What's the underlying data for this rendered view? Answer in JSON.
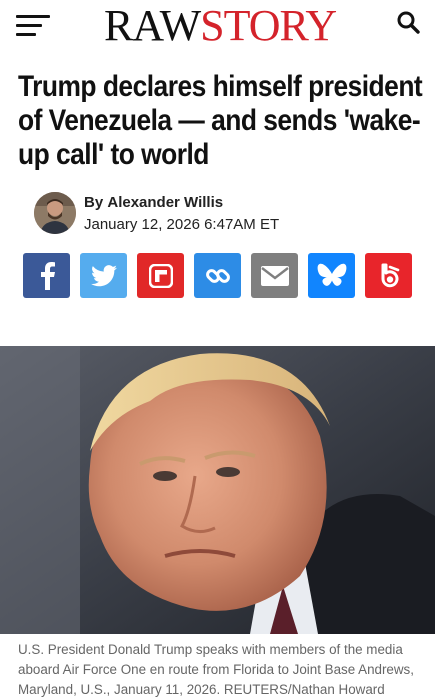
{
  "header": {
    "logo_part1": "RAW",
    "logo_part2": "STORY",
    "icons": {
      "menu": "hamburger-menu-icon",
      "search": "search-icon"
    }
  },
  "article": {
    "title": "Trump declares himself president of Venezuela — and sends 'wake-up call' to world",
    "byline_prefix": "By",
    "author": "Alexander Willis",
    "date": "January 12, 2026 6:47AM ET"
  },
  "share_buttons": [
    {
      "name": "facebook",
      "icon": "facebook-icon",
      "color": "#3b5998"
    },
    {
      "name": "twitter",
      "icon": "twitter-icon",
      "color": "#55acee"
    },
    {
      "name": "flipboard",
      "icon": "flipboard-icon",
      "color": "#e12828"
    },
    {
      "name": "copy-link",
      "icon": "link-icon",
      "color": "#2d8ce6"
    },
    {
      "name": "email",
      "icon": "email-icon",
      "color": "#7f7f7f"
    },
    {
      "name": "bluesky",
      "icon": "bluesky-icon",
      "color": "#1185fe"
    },
    {
      "name": "beehiiv",
      "icon": "beehiiv-icon",
      "color": "#e8252b"
    }
  ],
  "caption": "U.S. President Donald Trump speaks with members of the media aboard Air Force One en route from Florida to Joint Base Andrews, Maryland, U.S., January 11, 2026. REUTERS/Nathan Howard",
  "colors": {
    "brand_red": "#d4232b",
    "text": "#111111",
    "caption": "#666666"
  }
}
